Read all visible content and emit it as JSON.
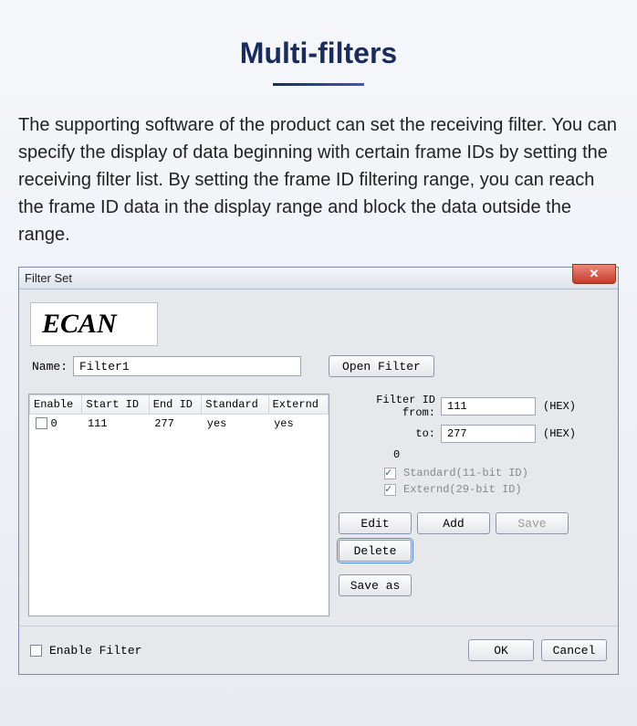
{
  "page": {
    "title": "Multi-filters",
    "description": "The supporting software of the product can set the receiving filter. You can specify the display of data beginning with certain frame IDs by setting the receiving filter list. By setting the frame ID filtering range, you can reach the frame ID data in the display range and block the data outside the range."
  },
  "window": {
    "title": "Filter Set",
    "close": "✕",
    "logo": "ECAN",
    "name_label": "Name:",
    "name_value": "Filter1",
    "open_filter": "Open Filter",
    "table": {
      "headers": [
        "Enable",
        "Start ID",
        "End ID",
        "Standard",
        "Externd"
      ],
      "row": {
        "enable": "0",
        "start": "111",
        "end": "277",
        "standard": "yes",
        "externd": "yes"
      }
    },
    "panel": {
      "from_label": "Filter ID from:",
      "from_value": "111",
      "to_label": "to:",
      "to_value": "277",
      "hex": "(HEX)",
      "zero": "0",
      "standard_label": "Standard(11-bit ID)",
      "externd_label": "Externd(29-bit ID)",
      "edit": "Edit",
      "add": "Add",
      "save": "Save",
      "delete": "Delete",
      "save_as": "Save as"
    },
    "bottom": {
      "enable_filter": "Enable Filter",
      "ok": "OK",
      "cancel": "Cancel"
    }
  }
}
